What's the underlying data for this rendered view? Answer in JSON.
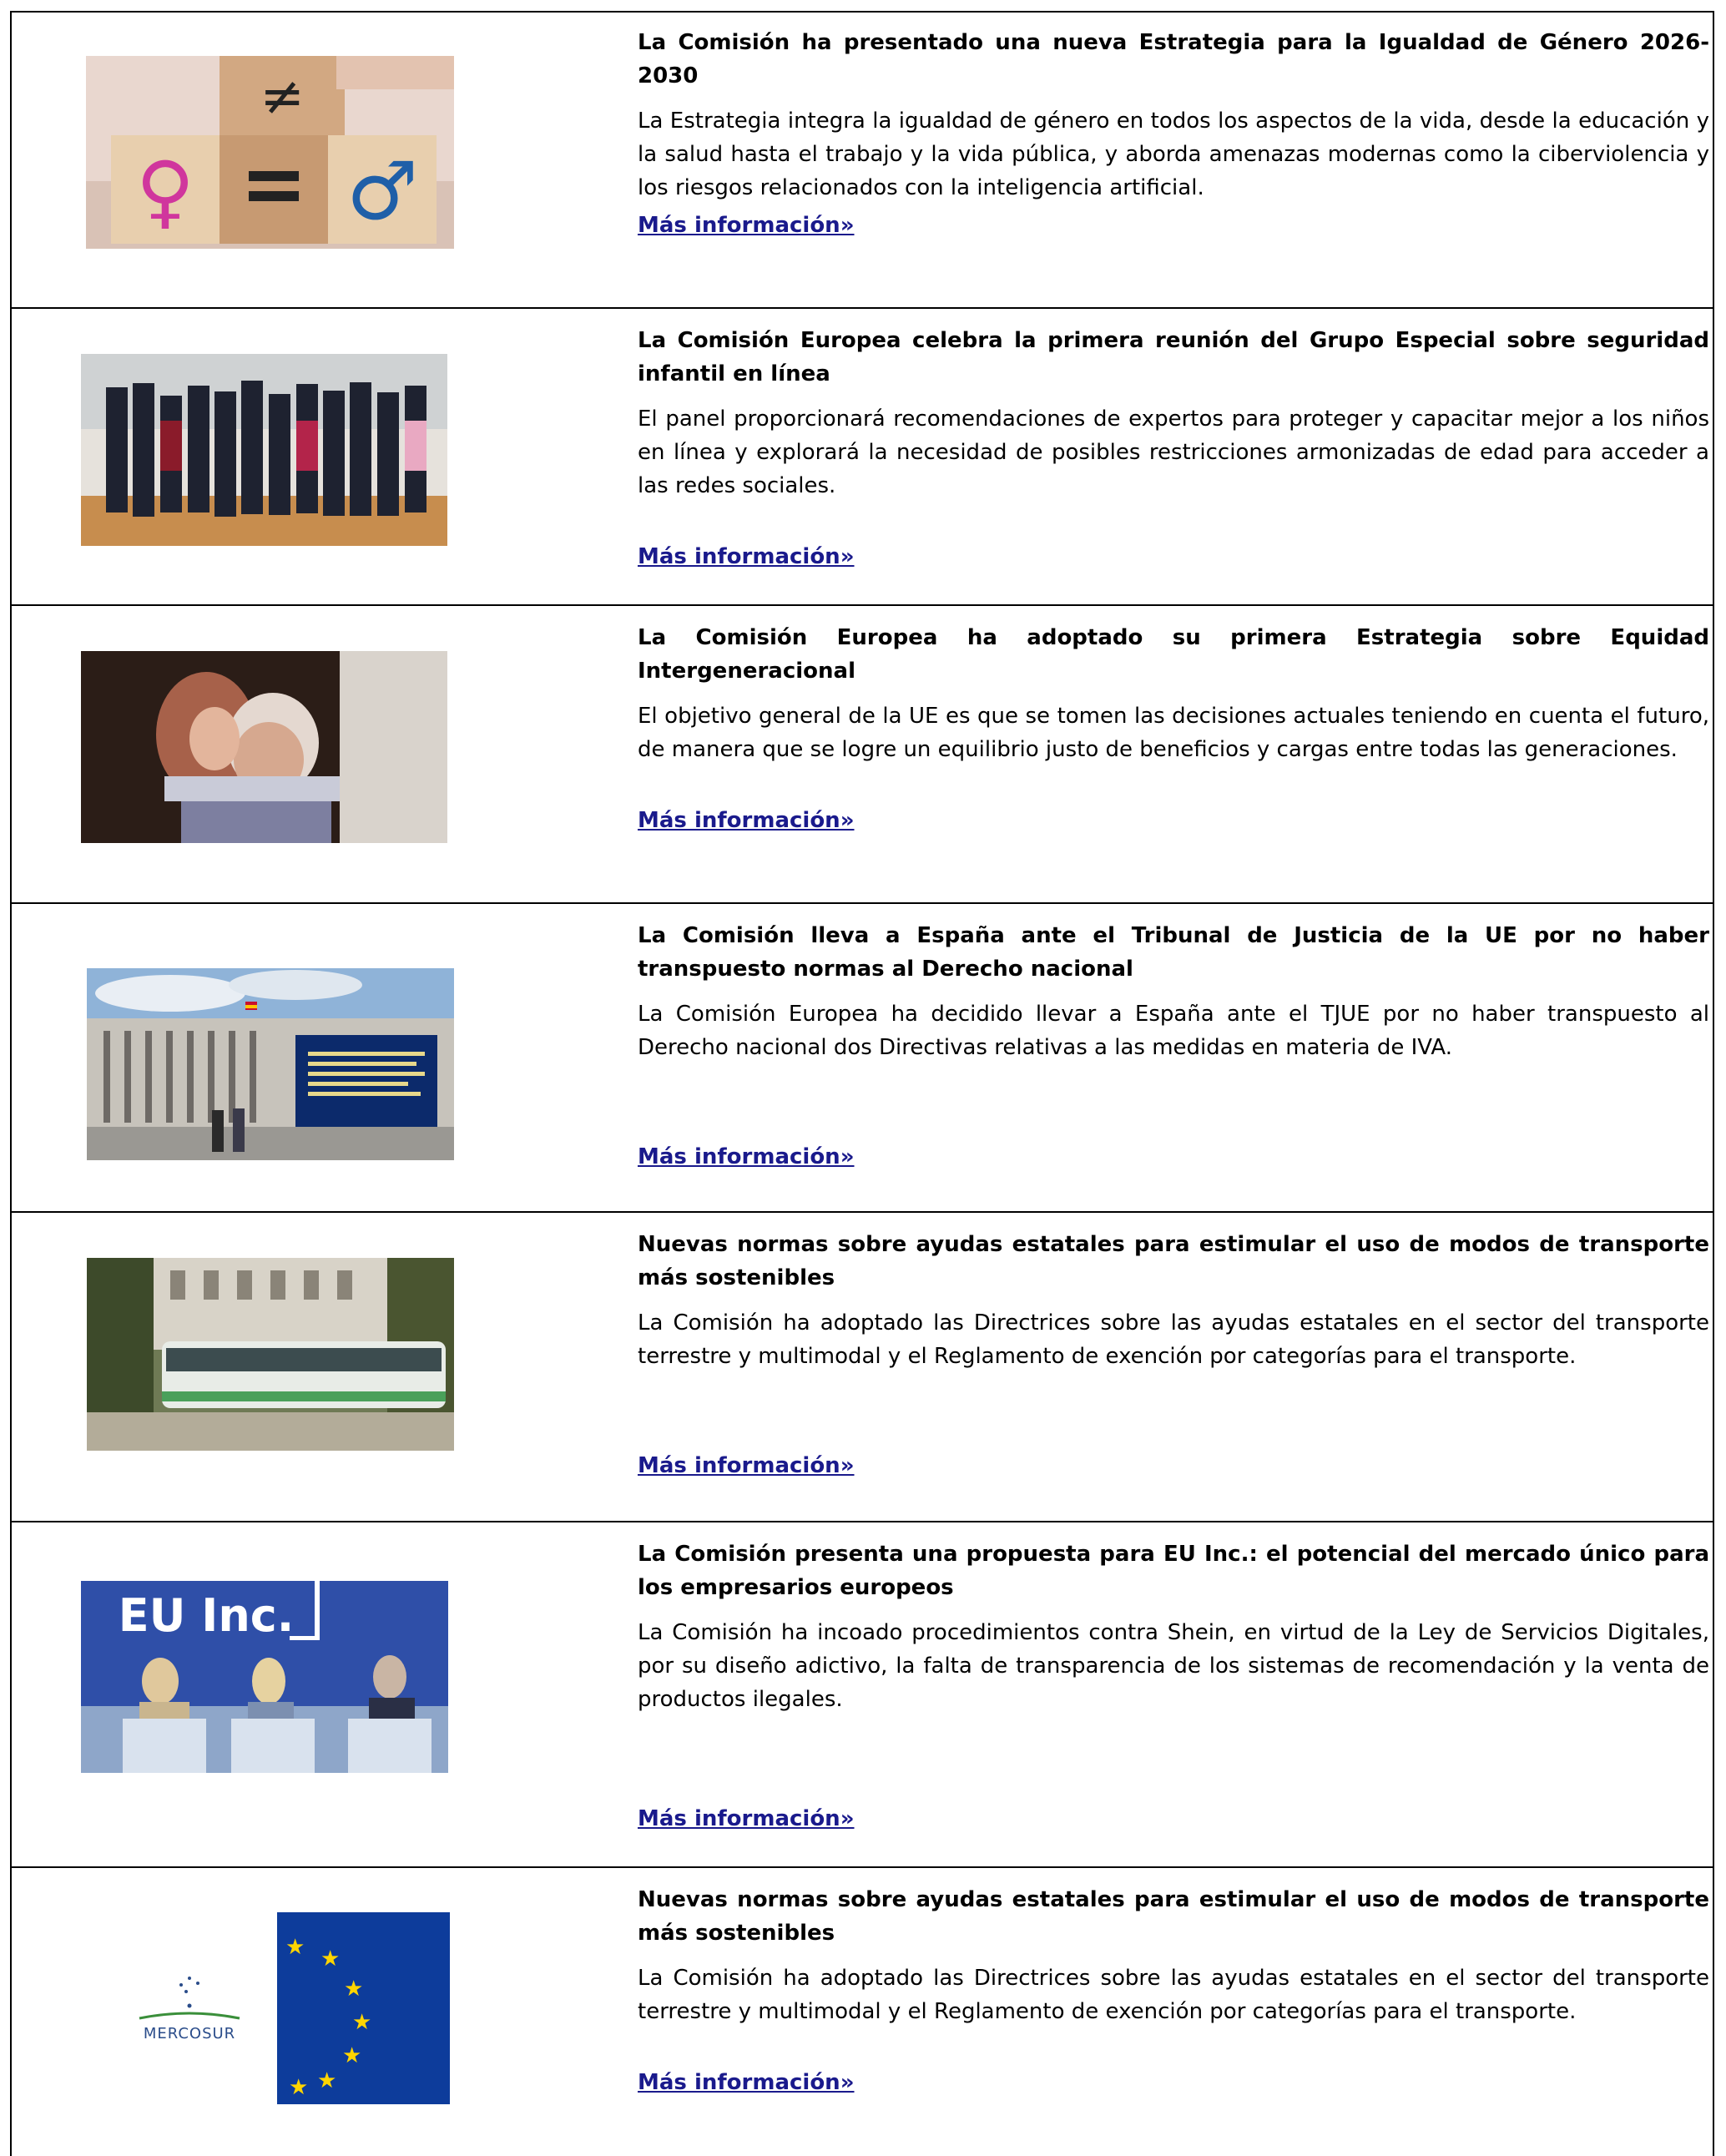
{
  "articles": [
    {
      "title": "La Comisión ha presentado una nueva Estrategia para la Igualdad de Género 2026-2030",
      "description": "La Estrategia integra la igualdad de género en todos los aspectos de la vida, desde la educación y la salud hasta el trabajo y la vida pública, y aborda amenazas modernas como la ciberviolencia y los riesgos relacionados con la inteligencia artificial.",
      "link": "Más información»",
      "image_icon": "gender-equality-blocks-image"
    },
    {
      "title": "La Comisión Europea celebra la primera reunión del Grupo Especial sobre seguridad infantil en línea",
      "description": "El panel proporcionará recomendaciones de expertos para proteger y capacitar mejor a los niños en línea y explorará la necesidad de posibles restricciones armonizadas de edad para acceder a las redes sociales.",
      "link": "Más información»",
      "image_icon": "group-photo-image"
    },
    {
      "title": "La Comisión Europea ha adoptado su primera Estrategia sobre Equidad Intergeneracional",
      "description": "El objetivo general de la UE es que se tomen las decisiones actuales teniendo en cuenta el futuro, de manera que se logre un equilibrio justo de beneficios y cargas entre todas las generaciones.",
      "link": "Más información»",
      "image_icon": "grandmother-child-hug-image"
    },
    {
      "title": "La Comisión lleva a España ante el Tribunal de Justicia de la UE por no haber transpuesto normas al Derecho nacional",
      "description": "La Comisión Europea ha decidido llevar a España ante el TJUE por no haber transpuesto al Derecho nacional dos Directivas relativas a las medidas en materia de IVA.",
      "link": "Más información»",
      "image_icon": "court-building-image"
    },
    {
      "title": "Nuevas normas sobre ayudas estatales para estimular el uso de modos de transporte más sostenibles",
      "description": "La Comisión ha adoptado las Directrices sobre las ayudas estatales en el sector del transporte terrestre y multimodal y el Reglamento de exención por categorías para el transporte.",
      "link": "Más información»",
      "image_icon": "tram-image"
    },
    {
      "title": "La Comisión presenta una propuesta para EU Inc.: el potencial del mercado único para los empresarios europeos",
      "description": "La Comisión ha incoado procedimientos contra Shein, en virtud de la Ley de Servicios Digitales, por su diseño adictivo, la falta de transparencia de los sistemas de recomendación y la venta de productos ilegales.",
      "link": "Más información»",
      "image_icon": "press-conference-image",
      "image_text": "EU Inc."
    },
    {
      "title": "Nuevas normas sobre ayudas estatales para estimular el uso de modos de transporte más sostenibles",
      "description": "La Comisión ha adoptado las Directrices sobre las ayudas estatales en el sector del transporte terrestre y multimodal y el Reglamento de exención por categorías para el transporte.",
      "link": "Más información»",
      "image_icon": "mercosur-eu-flags-image",
      "image_text": "MERCOSUR"
    }
  ],
  "colors": {
    "link": "#1a1a8c",
    "eu_blue": "#0d3c9b",
    "eu_star": "#ffd500"
  }
}
